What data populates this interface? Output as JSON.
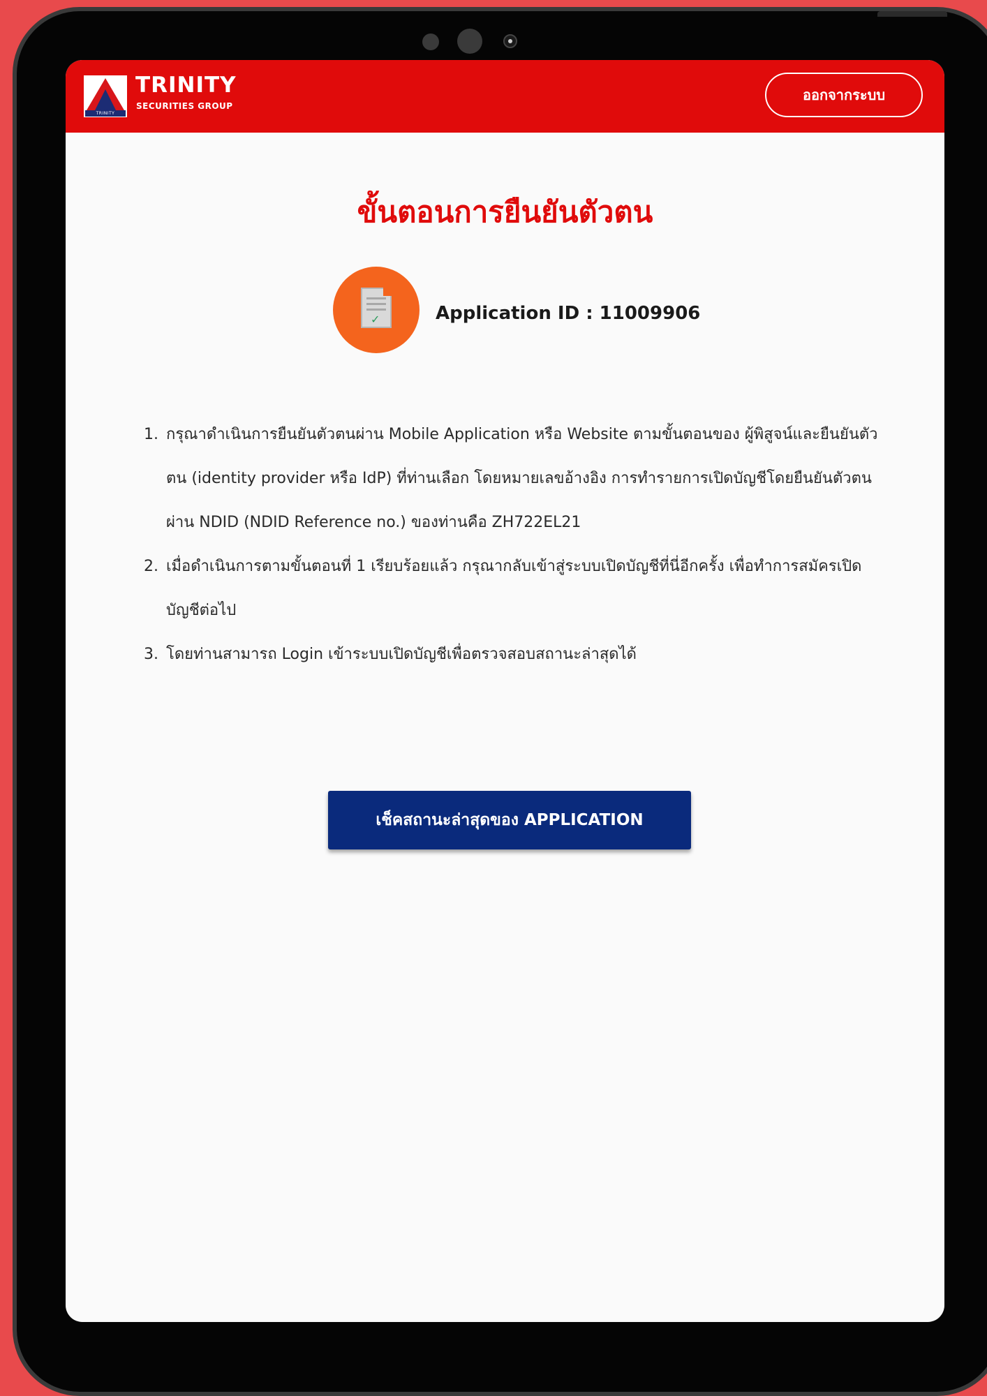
{
  "header": {
    "logo_name": "TRINITY",
    "logo_sub": "SECURITIES GROUP",
    "logo_mark_text": "TRINITY",
    "logout_label": "ออกจากระบบ",
    "bg_color": "#e00b0b"
  },
  "main": {
    "title": "ขั้นตอนการยืนยันตัวตน",
    "app_id_text": "Application ID : 11009906",
    "app_icon": "document-check-icon",
    "steps": [
      {
        "num": "1.",
        "text": "กรุณาดำเนินการยืนยันตัวตนผ่าน Mobile Application หรือ Website ตามขั้นตอนของ ผู้พิสูจน์และยืนยันตัวตน (identity provider หรือ IdP) ที่ท่านเลือก โดยหมายเลขอ้างอิง การทำรายการเปิดบัญชีโดยยืนยันตัวตนผ่าน NDID (NDID Reference no.) ของท่านคือ ZH722EL21"
      },
      {
        "num": "2.",
        "text": "เมื่อดำเนินการตามขั้นตอนที่ 1 เรียบร้อยแล้ว กรุณากลับเข้าสู่ระบบเปิดบัญชีที่นี่อีกครั้ง เพื่อทำการสมัครเปิดบัญชีต่อไป"
      },
      {
        "num": "3.",
        "text": "โดยท่านสามารถ Login เข้าระบบเปิดบัญชีเพื่อตรวจสอบสถานะล่าสุดได้"
      }
    ],
    "status_button_label": "เช็คสถานะล่าสุดของ APPLICATION",
    "status_button_color": "#0a2a7c"
  }
}
